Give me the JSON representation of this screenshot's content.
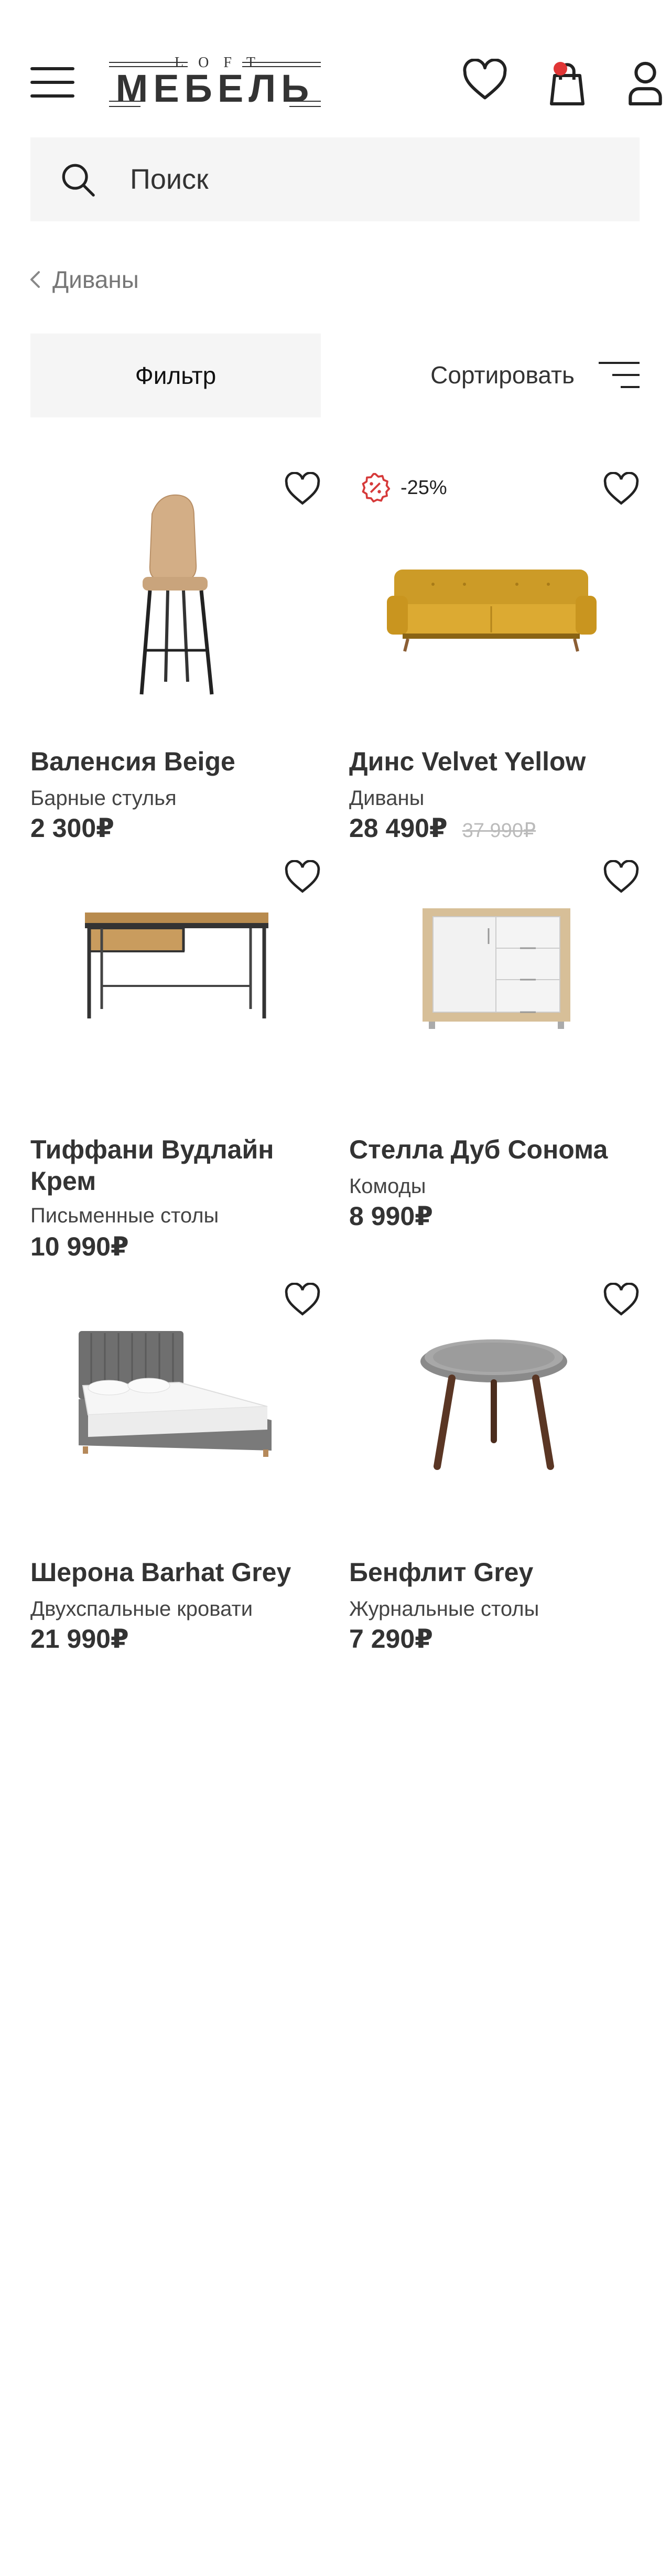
{
  "header": {
    "logo_top": "LOFT",
    "logo_main": "МЕБЕЛЬ",
    "menu_icon": "menu-icon",
    "favorites_icon": "heart-icon",
    "cart_icon": "shopping-bag-icon",
    "profile_icon": "user-icon",
    "cart_dot_color": "#e03535"
  },
  "search": {
    "placeholder": "Поиск"
  },
  "breadcrumb": {
    "label": "Диваны"
  },
  "toolbar": {
    "filter_label": "Фильтр",
    "sort_label": "Сортировать"
  },
  "products": [
    {
      "title": "Валенсия Beige",
      "category": "Барные стулья",
      "price": "2 300₽"
    },
    {
      "title": "Динс Velvet Yellow",
      "category": "Диваны",
      "price": "28 490₽",
      "old_price": "37 990₽",
      "badge": "-25%"
    },
    {
      "title": "Тиффани Вудлайн Крем",
      "category": "Письменные столы",
      "price": "10 990₽"
    },
    {
      "title": "Стелла Дуб Сонома",
      "category": "Комоды",
      "price": "8 990₽"
    },
    {
      "title": "Шерона Barhat Grey",
      "category": "Двухспальные кровати",
      "price": "21 990₽"
    },
    {
      "title": "Бенфлит Grey",
      "category": "Журнальные столы",
      "price": "7 290₽"
    }
  ]
}
